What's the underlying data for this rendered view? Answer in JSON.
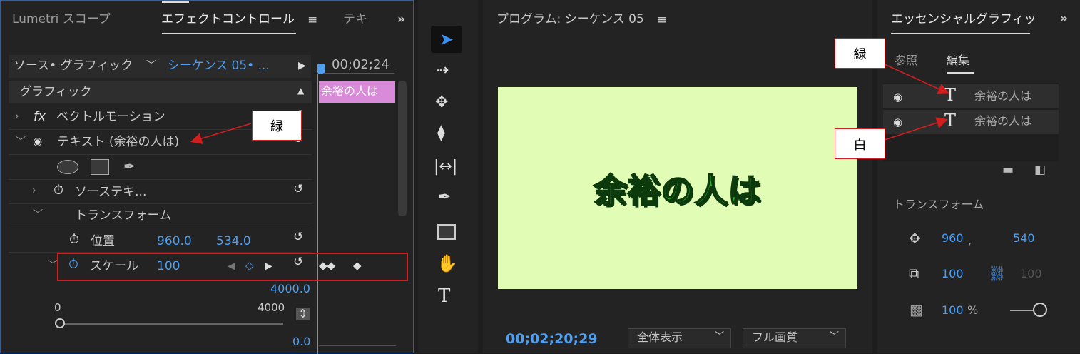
{
  "effect_panel": {
    "tab_lumetri": "Lumetri スコープ",
    "tab_effect_controls": "エフェクトコントロール",
    "tab_text_partial": "テキ",
    "source_label": "ソース• グラフィック",
    "sequence_label": "シーケンス 05• ...",
    "timecode_header": "00;02;24",
    "section_graphic": "グラフィック",
    "vector_motion": "ベクトルモーション",
    "text_layer": "テキスト (余裕の人は)",
    "source_text": "ソーステキ...",
    "transform": "トランスフォーム",
    "position_label": "位置",
    "position_x": "960.0",
    "position_y": "534.0",
    "scale_label": "スケール",
    "scale_value": "100",
    "graph_max_value": "4000.0",
    "slider_min": "0",
    "slider_max": "4000",
    "graph_min_value": "0.0",
    "clip_label": "余裕の人は",
    "fx_symbol": "fx"
  },
  "tools": [
    "selection",
    "track-select",
    "ripple-edit",
    "razor",
    "slip",
    "pen",
    "rectangle",
    "hand",
    "type"
  ],
  "program_monitor": {
    "title": "プログラム: シーケンス 05",
    "canvas_text": "余裕の人は",
    "timecode": "00;02;20;29",
    "zoom_option": "全体表示",
    "quality_option": "フル画質",
    "canvas_bg": "#e1fcb4",
    "text_fill": "#2bb52b",
    "text_stroke": "#0d3a0d"
  },
  "essential_graphics": {
    "title": "エッセンシャルグラフィッ",
    "tab_browse": "参照",
    "tab_edit": "編集",
    "layer1_name": "余裕の人は",
    "layer2_name": "余裕の人は",
    "transform_label": "トランスフォーム",
    "pos_x": "960",
    "pos_comma": ",",
    "pos_y": "540",
    "scale_x": "100",
    "scale_y": "100",
    "opacity": "100",
    "opacity_unit": "%"
  },
  "callouts": {
    "green_left": "緑",
    "green_right": "緑",
    "white_right": "白"
  },
  "colors": {
    "accent_blue": "#4d9ff2",
    "callout_red": "#d21e1e",
    "clip_pink": "#d98ad9"
  }
}
